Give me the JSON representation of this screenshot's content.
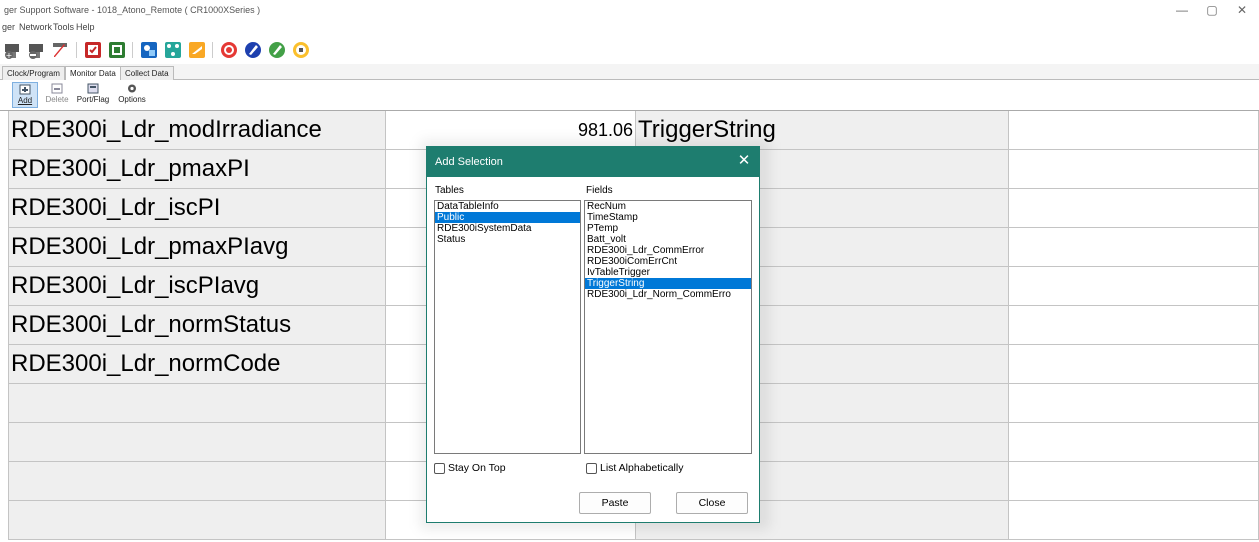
{
  "window": {
    "title": "ger Support Software - 1018_Atono_Remote ( CR1000XSeries )",
    "controls": [
      "—",
      "▢",
      "✕"
    ]
  },
  "menu": [
    "ger",
    "Network",
    "Tools",
    "Help"
  ],
  "toolbar_icons": [
    "connect-icon",
    "disconnect-icon",
    "pen-icon",
    "check-red-icon",
    "check-green-icon",
    "tools-blue-icon",
    "network-icon",
    "folder-icon",
    "target-icon",
    "blue-circle-icon",
    "green-circle-icon",
    "lock-circle-icon"
  ],
  "tabs": [
    "Clock/Program",
    "Monitor Data",
    "Collect Data"
  ],
  "active_tab": "Monitor Data",
  "subtoolbar": {
    "add": "Add",
    "delete": "Delete",
    "portflag": "Port/Flag",
    "options": "Options"
  },
  "grid": {
    "rows": [
      {
        "name": "RDE300i_Ldr_modIrradiance",
        "value": "981.06",
        "name2": "TriggerString"
      },
      {
        "name": "RDE300i_Ldr_pmaxPI",
        "value": "",
        "name2": ""
      },
      {
        "name": "RDE300i_Ldr_iscPI",
        "value": "",
        "name2": ""
      },
      {
        "name": "RDE300i_Ldr_pmaxPIavg",
        "value": "",
        "name2": ""
      },
      {
        "name": "RDE300i_Ldr_iscPIavg",
        "value": "",
        "name2": ""
      },
      {
        "name": "RDE300i_Ldr_normStatus",
        "value": "",
        "name2": ""
      },
      {
        "name": "RDE300i_Ldr_normCode",
        "value": "",
        "name2": ""
      },
      {
        "name": "",
        "value": "",
        "name2": ""
      },
      {
        "name": "",
        "value": "",
        "name2": ""
      },
      {
        "name": "",
        "value": "",
        "name2": ""
      },
      {
        "name": "",
        "value": "",
        "name2": ""
      }
    ]
  },
  "dialog": {
    "title": "Add Selection",
    "close_glyph": "✕",
    "tables_label": "Tables",
    "fields_label": "Fields",
    "tables": [
      "DataTableInfo",
      "Public",
      "RDE300iSystemData",
      "Status"
    ],
    "tables_selected": 1,
    "fields": [
      "RecNum",
      "TimeStamp",
      "PTemp",
      "Batt_volt",
      "RDE300i_Ldr_CommError",
      "RDE300iComErrCnt",
      "IvTableTrigger",
      "TriggerString",
      "RDE300i_Ldr_Norm_CommErro"
    ],
    "fields_selected": 7,
    "stay_on_top": "Stay On Top",
    "list_alpha": "List Alphabetically",
    "paste": "Paste",
    "close": "Close"
  },
  "colors": {
    "dialog_accent": "#1e7d6f",
    "selection": "#0078d7",
    "grid_shade": "#efefef"
  }
}
